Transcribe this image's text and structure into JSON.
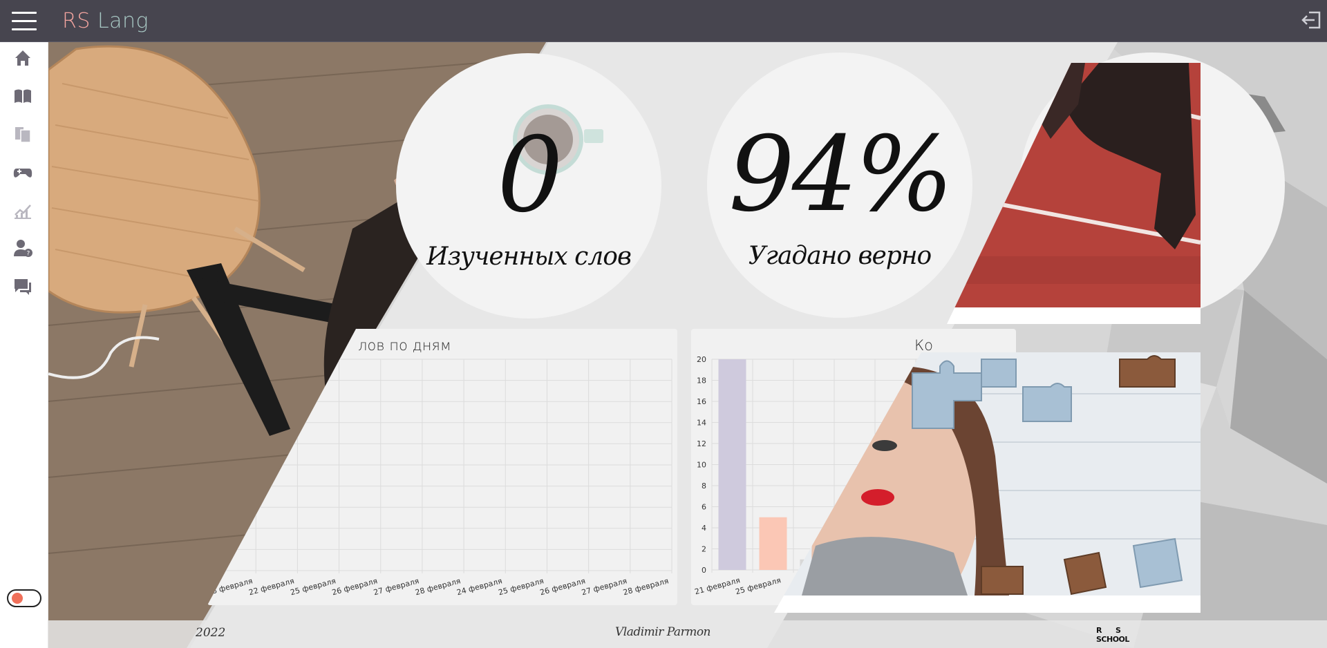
{
  "header": {
    "logo_rs": "RS",
    "logo_lang": "Lang",
    "logout_icon": "logout-icon"
  },
  "sidebar": {
    "items": [
      {
        "name": "home",
        "icon": "home-icon"
      },
      {
        "name": "textbook",
        "icon": "book-icon"
      },
      {
        "name": "dictionary",
        "icon": "cards-icon"
      },
      {
        "name": "games",
        "icon": "gamepad-icon"
      },
      {
        "name": "statistics",
        "icon": "chart-icon"
      },
      {
        "name": "team",
        "icon": "user-question-icon"
      },
      {
        "name": "feedback",
        "icon": "chat-icon"
      }
    ],
    "theme_toggle": "theme-toggle"
  },
  "stats": {
    "learned_value": "0",
    "learned_caption": "Изученных слов",
    "accuracy_value": "94%",
    "accuracy_caption": "Угадано верно"
  },
  "charts": {
    "left_title_visible": "лов по дням",
    "right_title_visible": "Ко"
  },
  "chart_data": [
    {
      "type": "line",
      "title": "лов по дням",
      "categories": [
        "28 февраля",
        "22 февраля",
        "25 февраля",
        "26 февраля",
        "27 февраля",
        "28 февраля",
        "24 февраля",
        "25 февраля",
        "26 февраля",
        "27 февраля",
        "28 февраля"
      ],
      "series": [],
      "grid": true
    },
    {
      "type": "bar",
      "title": "Ко",
      "categories": [
        "21 февраля",
        "25 февраля",
        "26"
      ],
      "values": [
        20,
        5,
        1
      ],
      "colors": [
        "#cfcadd",
        "#fbc7b5",
        "#d8d8d8"
      ],
      "ylim": [
        0,
        20
      ],
      "yticks": [
        0,
        2,
        4,
        6,
        8,
        10,
        12,
        14,
        16,
        18,
        20
      ],
      "grid": true
    }
  ],
  "footer": {
    "year": "2022",
    "author": "Vladimir Parmon",
    "school_r": "R",
    "school_s": "S",
    "school_word": "SCHOOL"
  },
  "colors": {
    "header_bg": "#47454f",
    "logo_rs": "#f4a5a0",
    "logo_lang": "#a8c8c4",
    "bar_purple": "#cfcadd",
    "bar_peach": "#fbc7b5"
  }
}
